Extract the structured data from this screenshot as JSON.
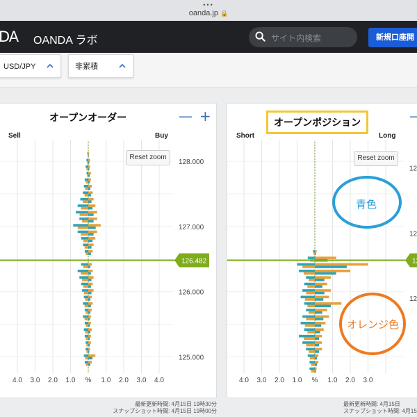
{
  "browser": {
    "dots": "•••",
    "url": "oanda.jp"
  },
  "header": {
    "logo": "DA",
    "title": "OANDA ラボ",
    "search_placeholder": "サイト内検索",
    "open_account_label": "新規口座開"
  },
  "filters": {
    "pair": "USD/JPY",
    "mode": "非累積"
  },
  "colors": {
    "buy": "#e89f35",
    "sell": "#2ea3b5",
    "price": "#7fac1c",
    "grid": "#e3e4e6"
  },
  "left_panel": {
    "title": "オープンオーダー",
    "side_left": "Sell",
    "side_right": "Buy",
    "reset_label": "Reset zoom",
    "minus": "—",
    "plus": "+",
    "current_price": "126.482",
    "price_ticks": [
      "128.000",
      "127.000",
      "126.000",
      "125.000"
    ],
    "x_ticks": [
      "4.0",
      "3.0",
      "2.0",
      "1.0",
      "%",
      "1.0",
      "2.0",
      "3.0",
      "4.0"
    ],
    "updated": "最新更新時間: 4月15日 19時30分",
    "snapshot": "スナップショット時間: 4月15日 19時00分"
  },
  "right_panel": {
    "title": "オープンポジション",
    "side_left": "Short",
    "side_right": "Long",
    "reset_label": "Reset zoom",
    "minus": "—",
    "current_price": "126",
    "price_ticks": [
      "12",
      "12",
      "12"
    ],
    "x_ticks": [
      "4.0",
      "3.0",
      "2.0",
      "1.0",
      "%",
      "1.0",
      "2.0",
      "3.0"
    ],
    "updated": "最新更新時間: 4月15日",
    "snapshot": "スナップショット時間: 4月15日"
  },
  "annotations": {
    "blue": "青色",
    "orange": "オレンジ色"
  },
  "chart_data": [
    {
      "type": "bar",
      "title": "オープンオーダー",
      "xlabel": "%",
      "ylim": [
        124.75,
        128.3
      ],
      "xlim": [
        -4.5,
        4.5
      ],
      "current_price": 126.482,
      "series": [
        {
          "name": "Sell",
          "color": "#2ea3b5",
          "values": [
            [
              128.1,
              0.05
            ],
            [
              128.0,
              0.1
            ],
            [
              127.9,
              0.15
            ],
            [
              127.8,
              0.1
            ],
            [
              127.7,
              0.2
            ],
            [
              127.6,
              0.25
            ],
            [
              127.5,
              0.3
            ],
            [
              127.4,
              0.45
            ],
            [
              127.3,
              0.6
            ],
            [
              127.2,
              0.7
            ],
            [
              127.1,
              0.5
            ],
            [
              127.0,
              0.85
            ],
            [
              126.9,
              0.6
            ],
            [
              126.8,
              0.4
            ],
            [
              126.7,
              0.3
            ],
            [
              126.6,
              0.2
            ],
            [
              126.4,
              0.4
            ],
            [
              126.3,
              0.6
            ],
            [
              126.2,
              0.5
            ],
            [
              126.1,
              0.4
            ],
            [
              126.0,
              0.35
            ],
            [
              125.9,
              0.25
            ],
            [
              125.8,
              0.3
            ],
            [
              125.7,
              0.2
            ],
            [
              125.6,
              0.3
            ],
            [
              125.5,
              0.2
            ],
            [
              125.4,
              0.25
            ],
            [
              125.3,
              0.2
            ],
            [
              125.2,
              0.15
            ],
            [
              125.1,
              0.15
            ],
            [
              125.0,
              0.25
            ],
            [
              124.9,
              0.2
            ]
          ]
        },
        {
          "name": "Buy",
          "color": "#e89f35",
          "values": [
            [
              128.1,
              0.05
            ],
            [
              128.0,
              0.1
            ],
            [
              127.9,
              0.1
            ],
            [
              127.8,
              0.15
            ],
            [
              127.7,
              0.15
            ],
            [
              127.6,
              0.2
            ],
            [
              127.5,
              0.25
            ],
            [
              127.4,
              0.3
            ],
            [
              127.3,
              0.4
            ],
            [
              127.2,
              0.5
            ],
            [
              127.1,
              0.5
            ],
            [
              127.0,
              0.7
            ],
            [
              126.9,
              0.5
            ],
            [
              126.8,
              0.4
            ],
            [
              126.7,
              0.3
            ],
            [
              126.6,
              0.25
            ],
            [
              126.4,
              0.2
            ],
            [
              126.3,
              0.25
            ],
            [
              126.2,
              0.3
            ],
            [
              126.1,
              0.25
            ],
            [
              126.0,
              0.3
            ],
            [
              125.9,
              0.2
            ],
            [
              125.8,
              0.25
            ],
            [
              125.7,
              0.2
            ],
            [
              125.6,
              0.15
            ],
            [
              125.5,
              0.15
            ],
            [
              125.4,
              0.2
            ],
            [
              125.3,
              0.15
            ],
            [
              125.2,
              0.15
            ],
            [
              125.1,
              0.1
            ],
            [
              125.0,
              0.4
            ],
            [
              124.9,
              0.2
            ]
          ]
        }
      ]
    },
    {
      "type": "bar",
      "title": "オープンポジション",
      "xlabel": "%",
      "ylim": [
        124.75,
        128.3
      ],
      "xlim": [
        -4.5,
        4.5
      ],
      "current_price": 126.482,
      "series": [
        {
          "name": "Short",
          "color": "#2ea3b5",
          "values": [
            [
              126.6,
              0.1
            ],
            [
              126.5,
              0.4
            ],
            [
              126.4,
              1.0
            ],
            [
              126.3,
              0.9
            ],
            [
              126.2,
              0.5
            ],
            [
              126.1,
              0.6
            ],
            [
              126.0,
              0.7
            ],
            [
              125.9,
              0.8
            ],
            [
              125.8,
              0.6
            ],
            [
              125.7,
              0.5
            ],
            [
              125.6,
              0.7
            ],
            [
              125.5,
              0.8
            ],
            [
              125.4,
              0.6
            ],
            [
              125.3,
              0.9
            ],
            [
              125.2,
              0.7
            ],
            [
              125.1,
              0.5
            ],
            [
              125.0,
              0.4
            ],
            [
              124.9,
              0.3
            ],
            [
              124.8,
              0.3
            ]
          ]
        },
        {
          "name": "Long",
          "color": "#e89f35",
          "values": [
            [
              126.6,
              0.1
            ],
            [
              126.5,
              1.2
            ],
            [
              126.4,
              3.0
            ],
            [
              126.3,
              2.0
            ],
            [
              126.2,
              0.9
            ],
            [
              126.1,
              0.7
            ],
            [
              126.0,
              0.9
            ],
            [
              125.9,
              0.8
            ],
            [
              125.8,
              1.5
            ],
            [
              125.7,
              0.7
            ],
            [
              125.6,
              0.8
            ],
            [
              125.5,
              0.6
            ],
            [
              125.4,
              0.5
            ],
            [
              125.3,
              0.4
            ],
            [
              125.2,
              0.4
            ],
            [
              125.1,
              0.4
            ],
            [
              125.0,
              0.2
            ],
            [
              124.9,
              0.2
            ],
            [
              124.8,
              0.1
            ]
          ]
        }
      ]
    }
  ]
}
